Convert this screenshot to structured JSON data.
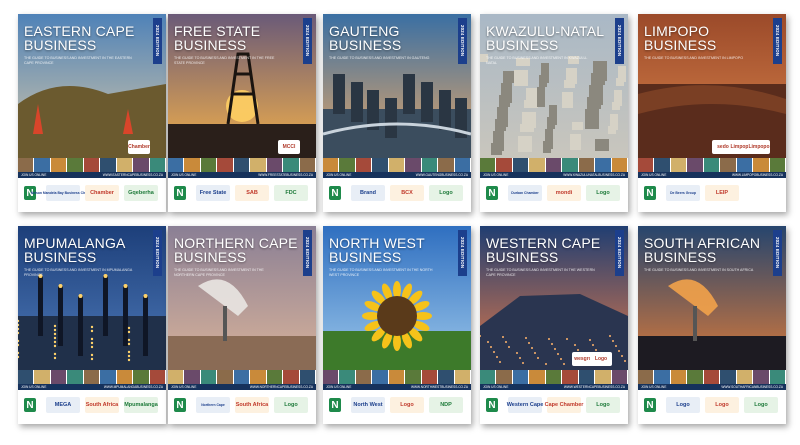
{
  "covers": [
    {
      "title_l1": "EASTERN CAPE",
      "title_l2": "BUSINESS",
      "edition": "2024 EDITION",
      "subtitle": "THE GUIDE TO BUSINESS AND INVESTMENT IN THE EASTERN CAPE PROVINCE",
      "bar_left": "JOIN US ONLINE",
      "bar_right": "WWW.EASTERNCAPEBUSINESS.CO.ZA",
      "logos": [
        "Nelson Mandela Bay Business Chamber",
        "Chamber",
        "Gqeberha"
      ],
      "upper_logos": [
        "Chamber"
      ],
      "sky_top": "#4f82b8",
      "sky_bottom": "#d8c9a8",
      "ground": "#6b5a2f",
      "accent": "#d9452a"
    },
    {
      "title_l1": "FREE STATE",
      "title_l2": "BUSINESS",
      "edition": "2024 EDITION",
      "subtitle": "THE GUIDE TO BUSINESS AND INVESTMENT IN THE FREE STATE PROVINCE",
      "bar_left": "JOIN US ONLINE",
      "bar_right": "WWW.FREESTATEBUSINESS.CO.ZA",
      "logos": [
        "Free State",
        "SAB",
        "FDC"
      ],
      "upper_logos": [
        "MCCI"
      ],
      "sky_top": "#6a5a78",
      "sky_bottom": "#f3b04a",
      "ground": "#2a1f1a",
      "accent": "#ffcf63"
    },
    {
      "title_l1": "GAUTENG",
      "title_l2": "BUSINESS",
      "edition": "2024 EDITION",
      "subtitle": "THE GUIDE TO BUSINESS AND INVESTMENT IN GAUTENG",
      "bar_left": "JOIN US ONLINE",
      "bar_right": "WWW.GAUTENGBUSINESS.CO.ZA",
      "logos": [
        "Brand",
        "BCX",
        "Logo"
      ],
      "upper_logos": [],
      "sky_top": "#3a6fa3",
      "sky_bottom": "#e7a867",
      "ground": "#3b4d5e",
      "accent": "#f0c27a"
    },
    {
      "title_l1": "KWAZULU-NATAL",
      "title_l2": "BUSINESS",
      "edition": "2024 EDITION",
      "subtitle": "THE GUIDE TO BUSINESS AND INVESTMENT IN KWAZULU-NATAL",
      "bar_left": "JOIN US ONLINE",
      "bar_right": "WWW.KWAZULUNATALBUSINESS.CO.ZA",
      "logos": [
        "Durban Chamber",
        "mondi",
        "Logo"
      ],
      "upper_logos": [],
      "sky_top": "#a9b8c6",
      "sky_bottom": "#c9c6bd",
      "ground": "#7a776c",
      "accent": "#b8b2a3"
    },
    {
      "title_l1": "LIMPOPO",
      "title_l2": "BUSINESS",
      "edition": "2024 EDITION",
      "subtitle": "THE GUIDE TO BUSINESS AND INVESTMENT IN LIMPOPO",
      "bar_left": "JOIN US ONLINE",
      "bar_right": "WWW.LIMPOPOBUSINESS.CO.ZA",
      "logos": [
        "De Beers Group",
        "LEIP"
      ],
      "upper_logos": [
        "sedo",
        "Limpopo",
        "Limpopo"
      ],
      "sky_top": "#9b4a2a",
      "sky_bottom": "#d9834a",
      "ground": "#5a2c1c",
      "accent": "#e9a060"
    },
    {
      "title_l1": "MPUMALANGA",
      "title_l2": "BUSINESS",
      "edition": "2024 EDITION",
      "subtitle": "THE GUIDE TO BUSINESS AND INVESTMENT IN MPUMALANGA PROVINCE",
      "bar_left": "JOIN US ONLINE",
      "bar_right": "WWW.MPUMALANGABUSINESS.CO.ZA",
      "logos": [
        "MEGA",
        "South Africa",
        "Mpumalanga"
      ],
      "upper_logos": [],
      "sky_top": "#1d3f7a",
      "sky_bottom": "#4d79b8",
      "ground": "#20304a",
      "accent": "#ffd36b"
    },
    {
      "title_l1": "NORTHERN CAPE",
      "title_l2": "BUSINESS",
      "edition": "2024 EDITION",
      "subtitle": "THE GUIDE TO BUSINESS AND INVESTMENT IN THE NORTHERN CAPE PROVINCE",
      "bar_left": "JOIN US ONLINE",
      "bar_right": "WWW.NORTHERNCAPEBUSINESS.CO.ZA",
      "logos": [
        "Northern Cape",
        "South Africa",
        "Logo"
      ],
      "upper_logos": [],
      "sky_top": "#8a7f95",
      "sky_bottom": "#d9b39a",
      "ground": "#8a6b55",
      "accent": "#e9e6e2"
    },
    {
      "title_l1": "NORTH WEST",
      "title_l2": "BUSINESS",
      "edition": "2024 EDITION",
      "subtitle": "THE GUIDE TO BUSINESS AND INVESTMENT IN THE NORTH WEST PROVINCE",
      "bar_left": "JOIN US ONLINE",
      "bar_right": "WWW.NORTHWESTBUSINESS.CO.ZA",
      "logos": [
        "North West",
        "Logo",
        "NDP"
      ],
      "upper_logos": [],
      "sky_top": "#2f6fc0",
      "sky_bottom": "#9cc7ea",
      "ground": "#3d7a2a",
      "accent": "#f6c21a"
    },
    {
      "title_l1": "WESTERN CAPE",
      "title_l2": "BUSINESS",
      "edition": "2024 EDITION",
      "subtitle": "THE GUIDE TO BUSINESS AND INVESTMENT IN THE WESTERN CAPE PROVINCE",
      "bar_left": "JOIN US ONLINE",
      "bar_right": "WWW.WESTERNCAPEBUSINESS.CO.ZA",
      "logos": [
        "Western Cape",
        "Cape Chamber",
        "Logo"
      ],
      "upper_logos": [
        "wesgro",
        "Logo"
      ],
      "sky_top": "#203e72",
      "sky_bottom": "#e07a4a",
      "ground": "#1b2233",
      "accent": "#ffb36b"
    },
    {
      "title_l1": "SOUTH AFRICAN",
      "title_l2": "BUSINESS",
      "edition": "2024 EDITION",
      "subtitle": "THE GUIDE TO BUSINESS AND INVESTMENT IN SOUTH AFRICA",
      "bar_left": "JOIN US ONLINE",
      "bar_right": "WWW.SOUTHAFRICANBUSINESS.CO.ZA",
      "logos": [
        "Logo",
        "Logo",
        "Logo"
      ],
      "upper_logos": [],
      "sky_top": "#26456e",
      "sky_bottom": "#d97a3a",
      "ground": "#1d1b22",
      "accent": "#f2a24a"
    }
  ],
  "strip_colors": [
    "#8b6b4a",
    "#3b6ea3",
    "#c98a3a",
    "#5a7a3a",
    "#a54a3a",
    "#2f4f6f",
    "#d1b06a",
    "#6a4a6a",
    "#3a8a7a"
  ]
}
